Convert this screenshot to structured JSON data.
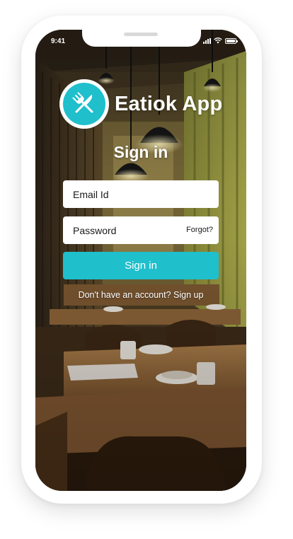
{
  "status_bar": {
    "time": "9:41"
  },
  "brand": {
    "name": "Eatiok App",
    "logo_icon": "fork-knife-icon"
  },
  "heading": "Sign in",
  "form": {
    "email_placeholder": "Email Id",
    "password_placeholder": "Password",
    "forgot_label": "Forgot?",
    "submit_label": "Sign in"
  },
  "footer": {
    "prompt": "Don't have an account?",
    "signup_label": "Sign up"
  },
  "colors": {
    "accent": "#1fbfcc",
    "text_on_image": "#ffffff"
  }
}
